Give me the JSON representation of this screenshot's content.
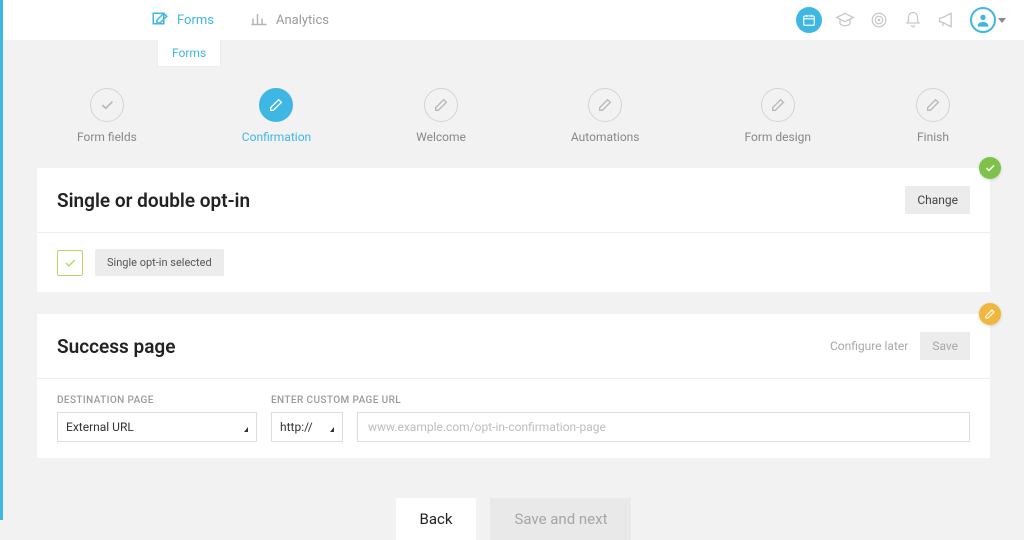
{
  "topnav": {
    "forms": "Forms",
    "analytics": "Analytics",
    "subtab": "Forms"
  },
  "icons": {
    "calendar": "calendar-icon",
    "grad": "graduation-icon",
    "target": "target-icon",
    "bell": "bell-icon",
    "megaphone": "megaphone-icon",
    "avatar": "avatar-icon"
  },
  "steps": [
    {
      "label": "Form fields"
    },
    {
      "label": "Confirmation"
    },
    {
      "label": "Welcome"
    },
    {
      "label": "Automations"
    },
    {
      "label": "Form design"
    },
    {
      "label": "Finish"
    }
  ],
  "optin": {
    "title": "Single or double opt-in",
    "change": "Change",
    "status": "Single opt-in selected"
  },
  "success": {
    "title": "Success page",
    "configure_later": "Configure later",
    "save": "Save",
    "dest_label": "DESTINATION PAGE",
    "dest_value": "External URL",
    "url_label": "ENTER CUSTOM PAGE URL",
    "protocol_value": "http://",
    "url_placeholder": "www.example.com/opt-in-confirmation-page"
  },
  "bottom": {
    "back": "Back",
    "next": "Save and next"
  }
}
